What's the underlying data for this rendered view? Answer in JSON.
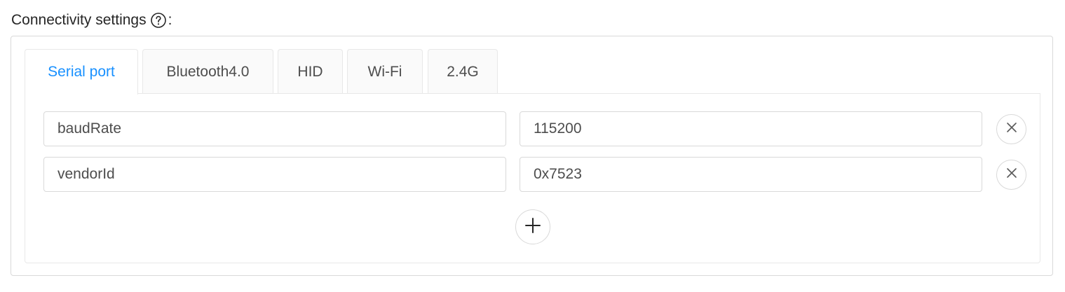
{
  "section": {
    "label": "Connectivity settings",
    "colon": ":",
    "help_icon": "question-circle-icon"
  },
  "tabs": [
    {
      "label": "Serial port",
      "active": true
    },
    {
      "label": "Bluetooth4.0",
      "active": false
    },
    {
      "label": "HID",
      "active": false
    },
    {
      "label": "Wi-Fi",
      "active": false
    },
    {
      "label": "2.4G",
      "active": false
    }
  ],
  "params": [
    {
      "key": "baudRate",
      "value": "115200",
      "remove_icon": "close-icon"
    },
    {
      "key": "vendorId",
      "value": "0x7523",
      "remove_icon": "close-icon"
    }
  ],
  "add_icon": "plus-icon",
  "colors": {
    "accent": "#1890ff",
    "border": "#d9d9d9",
    "tab_bg": "#fafafa",
    "text": "#4d4d4d"
  }
}
